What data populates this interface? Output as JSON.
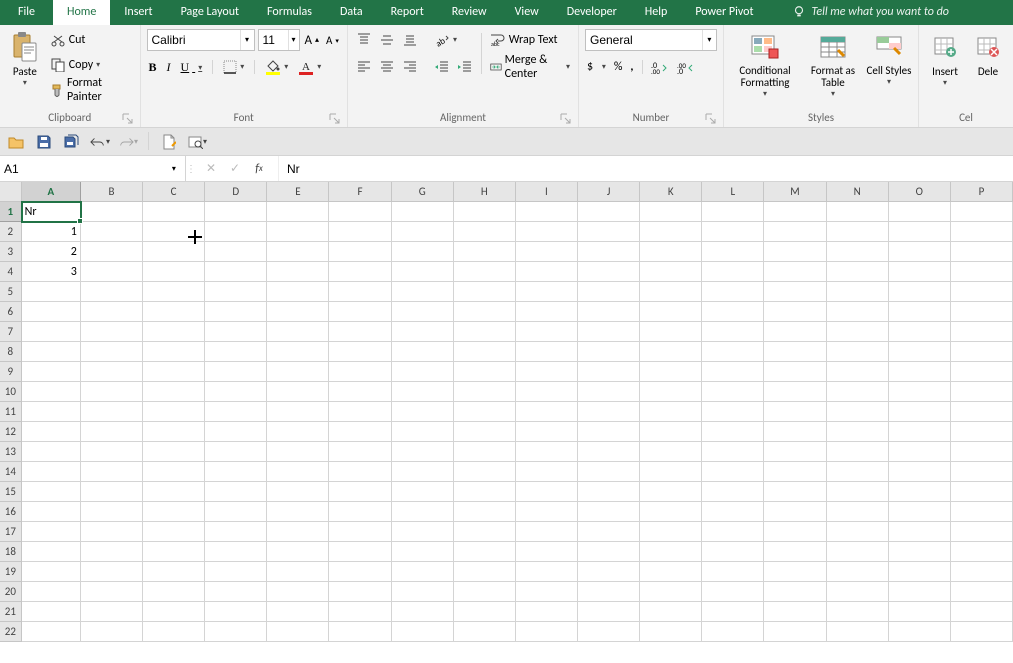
{
  "menu": {
    "tabs": [
      "File",
      "Home",
      "Insert",
      "Page Layout",
      "Formulas",
      "Data",
      "Report",
      "Review",
      "View",
      "Developer",
      "Help",
      "Power Pivot"
    ],
    "active": "Home",
    "tell_me": "Tell me what you want to do"
  },
  "ribbon": {
    "clipboard": {
      "label": "Clipboard",
      "paste": "Paste",
      "cut": "Cut",
      "copy": "Copy",
      "format_painter": "Format Painter"
    },
    "font": {
      "label": "Font",
      "name": "Calibri",
      "size": "11",
      "bold": "B",
      "italic": "I",
      "underline": "U"
    },
    "alignment": {
      "label": "Alignment",
      "wrap": "Wrap Text",
      "merge": "Merge & Center"
    },
    "number": {
      "label": "Number",
      "format": "General",
      "currency_sign": "$",
      "percent": "%",
      "comma": ","
    },
    "styles": {
      "label": "Styles",
      "conditional": "Conditional Formatting",
      "format_table": "Format as Table",
      "cell_styles": "Cell Styles"
    },
    "cells": {
      "label": "Cel",
      "insert": "Insert",
      "delete": "Dele"
    }
  },
  "formula_bar": {
    "name_box": "A1",
    "formula": "Nr"
  },
  "sheet": {
    "columns": [
      "A",
      "B",
      "C",
      "D",
      "E",
      "F",
      "G",
      "H",
      "I",
      "J",
      "K",
      "L",
      "M",
      "N",
      "O",
      "P"
    ],
    "rows": [
      1,
      2,
      3,
      4,
      5,
      6,
      7,
      8,
      9,
      10,
      11,
      12,
      13,
      14,
      15,
      16,
      17,
      18,
      19,
      20,
      21,
      22
    ],
    "cells": {
      "A1": "Nr",
      "A2": "1",
      "A3": "2",
      "A4": "3"
    },
    "selected": "A1"
  }
}
